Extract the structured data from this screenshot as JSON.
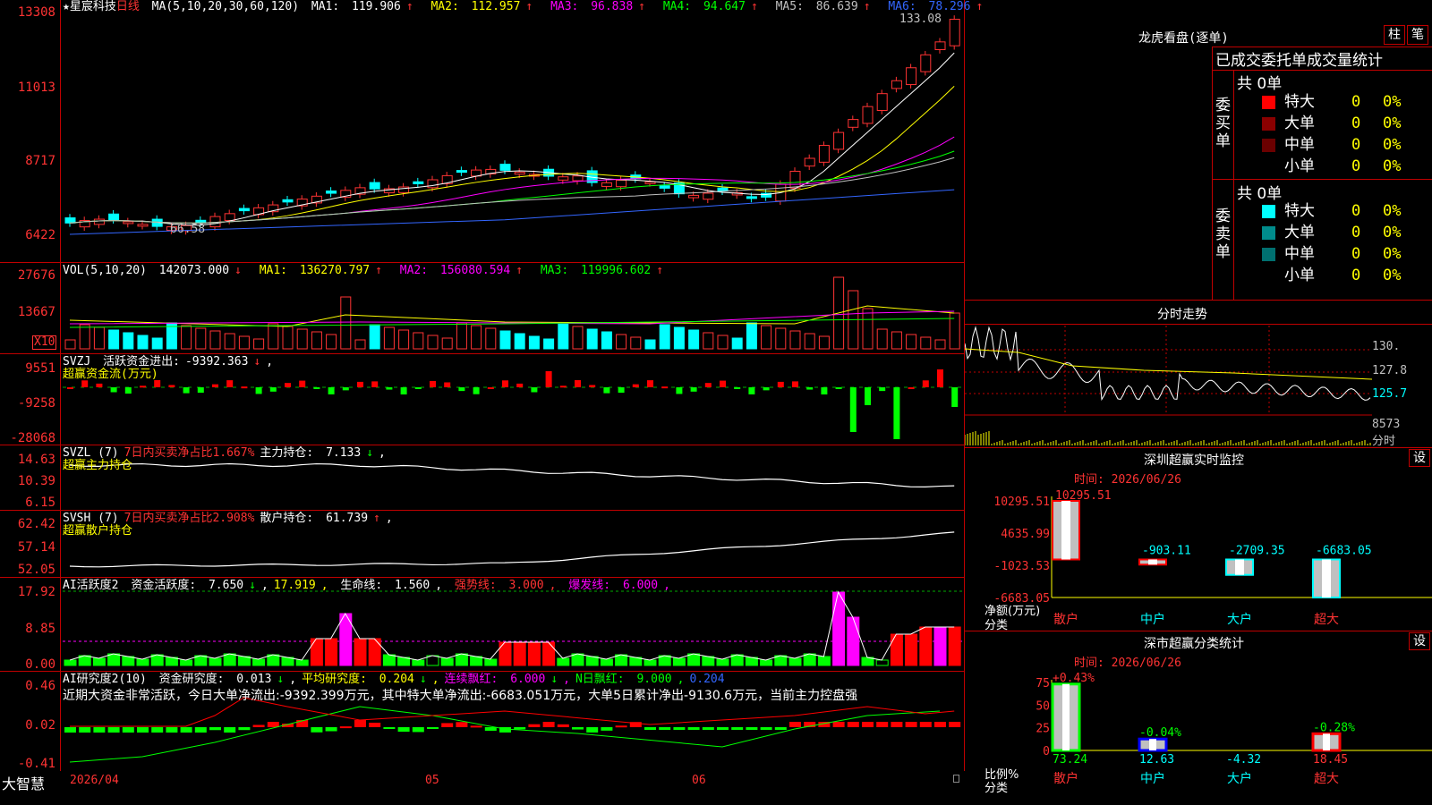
{
  "app": {
    "name": "大智慧",
    "stock_name": "★星宸科技",
    "period": "日线",
    "date_labels": [
      "2026/04",
      "05",
      "06"
    ]
  },
  "colors": {
    "up": "#ff3333",
    "down": "#00ffff",
    "ma1": "#ffffff",
    "ma2": "#ffff00",
    "ma3": "#ff00ff",
    "ma4": "#00ff00",
    "ma5": "#c0c0c0",
    "ma6": "#3366ff",
    "grid": "#c00000"
  },
  "price_panel": {
    "ma_title": "MA(5,10,20,30,60,120)",
    "ma": [
      {
        "label": "MA1:",
        "value": "119.906",
        "arrow": "↑"
      },
      {
        "label": "MA2:",
        "value": "112.957",
        "arrow": "↑"
      },
      {
        "label": "MA3:",
        "value": "96.838",
        "arrow": "↑"
      },
      {
        "label": "MA4:",
        "value": "94.647",
        "arrow": "↑"
      },
      {
        "label": "MA5:",
        "value": "86.639",
        "arrow": "↑"
      },
      {
        "label": "MA6:",
        "value": "78.296",
        "arrow": "↑"
      }
    ],
    "axis": [
      "13308",
      "11013",
      "8717",
      "6422"
    ],
    "high_label": "133.08",
    "low_label": "66.58"
  },
  "vol_panel": {
    "title": "VOL(5,10,20)",
    "value": "142073.000",
    "ma": [
      {
        "label": "MA1:",
        "value": "136270.797",
        "arrow": "↑"
      },
      {
        "label": "MA2:",
        "value": "156080.594",
        "arrow": "↑"
      },
      {
        "label": "MA3:",
        "value": "119996.602",
        "arrow": "↑"
      }
    ],
    "axis": [
      "27676",
      "13667"
    ],
    "unit": "X10"
  },
  "svzj_panel": {
    "title": "SVZJ",
    "label": "活跃资金进出:",
    "value": "-9392.363",
    "subtitle": "超赢资金流(万元)",
    "axis": [
      "9551",
      "-9258",
      "-28068"
    ]
  },
  "svzl_panel": {
    "title": "SVZL (7)",
    "label1": "7日内买卖净占比1.667%",
    "label2": "主力持仓:",
    "value": "7.133",
    "subtitle": "超赢主力持仓",
    "axis": [
      "14.63",
      "10.39",
      "6.15"
    ]
  },
  "svsh_panel": {
    "title": "SVSH (7)",
    "label1": "7日内买卖净占比2.908%",
    "label2": "散户持仓:",
    "value": "61.739",
    "subtitle": "超赢散户持仓",
    "axis": [
      "62.42",
      "57.14",
      "52.05"
    ]
  },
  "ai2_panel": {
    "title": "AI活跃度2",
    "label1": "资金活跃度:",
    "value1": "7.650",
    "value2": "17.919",
    "label3": "生命线:",
    "value3": "1.560",
    "label4": "强势线:",
    "value4": "3.000",
    "label5": "爆发线:",
    "value5": "6.000",
    "axis": [
      "17.92",
      "8.85",
      "0.00"
    ]
  },
  "ai_research_panel": {
    "title": "AI研究度2(10)",
    "label1": "资金研究度:",
    "value1": "0.013",
    "label2": "平均研究度:",
    "value2": "0.204",
    "label3": "连续飘红:",
    "value3": "6.000",
    "label4": "N日飘红:",
    "value4": "9.000",
    "value5": "0.204",
    "summary": "近期大资金非常活跃，今日大单净流出:-9392.399万元，其中特大单净流出:-6683.051万元，大单5日累计净出-9130.6万元，当前主力控盘强",
    "axis": [
      "0.46",
      "0.02",
      "-0.41"
    ]
  },
  "lhb": {
    "title": "龙虎看盘(逐单)",
    "btn1": "柱",
    "btn2": "笔",
    "tabs": "已成交委托单成交量统计",
    "buy_side": "委买单",
    "sell_side": "委卖单",
    "buy_total": "共 0单",
    "sell_total": "共 0单",
    "buy_rows": [
      {
        "label": "特大",
        "count": "0",
        "pct": "0%",
        "color": "#ff0000"
      },
      {
        "label": "大单",
        "count": "0",
        "pct": "0%",
        "color": "#8b0000"
      },
      {
        "label": "中单",
        "count": "0",
        "pct": "0%",
        "color": "#6b0000"
      },
      {
        "label": "小单",
        "count": "0",
        "pct": "0%",
        "color": "#000000"
      }
    ],
    "sell_rows": [
      {
        "label": "特大",
        "count": "0",
        "pct": "0%",
        "color": "#00ffff"
      },
      {
        "label": "大单",
        "count": "0",
        "pct": "0%",
        "color": "#008b8b"
      },
      {
        "label": "中单",
        "count": "0",
        "pct": "0%",
        "color": "#007070"
      },
      {
        "label": "小单",
        "count": "0",
        "pct": "0%",
        "color": "#000000"
      }
    ]
  },
  "intraday": {
    "title": "分时走势",
    "labels": [
      "130.",
      "127.8",
      "125.7",
      "8573",
      "分时"
    ]
  },
  "monitor": {
    "title": "深圳超赢实时监控",
    "btn": "设",
    "time_label": "时间: 2026/06/26",
    "yaxis": [
      "10295.51",
      "4635.99",
      "-1023.53",
      "-6683.05"
    ],
    "ylabel": "净额(万元)",
    "xlabel": "分类",
    "categories": [
      "散户",
      "中户",
      "大户",
      "超大"
    ],
    "values": [
      "10295.51",
      "-903.11",
      "-2709.35",
      "-6683.05"
    ]
  },
  "classify": {
    "title": "深市超赢分类统计",
    "btn": "设",
    "time_label": "时间: 2026/06/26",
    "yaxis": [
      "75",
      "50",
      "25",
      "0"
    ],
    "ylabel": "比例%",
    "xlabel": "分类",
    "categories": [
      "散户",
      "中户",
      "大户",
      "超大"
    ],
    "top_labels": [
      "+0.43%",
      "-0.04%",
      "",
      "-0.28%"
    ],
    "bottom_values": [
      "73.24",
      "12.63",
      "-4.32",
      "18.45"
    ]
  },
  "chart_data": [
    {
      "type": "bar",
      "title": "深圳超赢实时监控",
      "ylabel": "净额(万元)",
      "xlabel": "分类",
      "categories": [
        "散户",
        "中户",
        "大户",
        "超大"
      ],
      "values": [
        10295.51,
        -903.11,
        -2709.35,
        -6683.05
      ],
      "ylim": [
        -6683.05,
        10295.51
      ]
    },
    {
      "type": "bar",
      "title": "深市超赢分类统计",
      "ylabel": "比例%",
      "xlabel": "分类",
      "categories": [
        "散户",
        "中户",
        "大户",
        "超大"
      ],
      "values": [
        73.24,
        12.63,
        -4.32,
        18.45
      ],
      "ylim": [
        0,
        75
      ]
    }
  ]
}
